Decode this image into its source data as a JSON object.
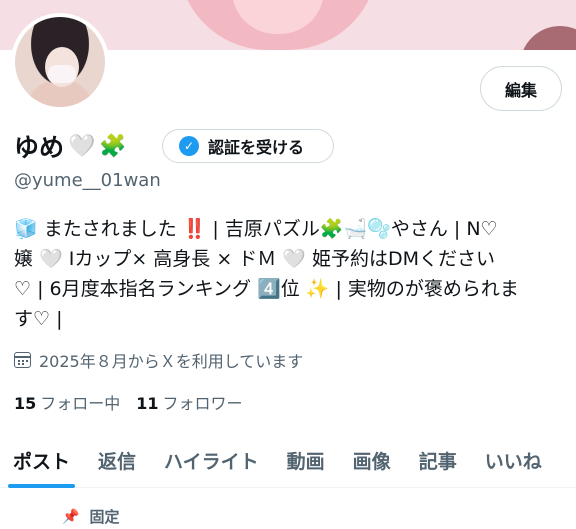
{
  "profile": {
    "display_name": "ゆめ",
    "name_emojis": [
      "🤍",
      "🧩"
    ],
    "verify_label": "認証を受ける",
    "handle": "@yume__01wan",
    "edit_label": "編集"
  },
  "bio": {
    "line1": "🧊 またされました ‼️ | 吉原パズル🧩🛁🫧やさん | N♡",
    "line2": "嬢 🤍 Iカップ× 高身長 × ドＭ 🤍 姫予約はDMください",
    "line3": "♡ | 6月度本指名ランキング 4️⃣位 ✨ | 実物のが褒められま",
    "line4": "す♡ |"
  },
  "joined": "2025年８月からＸを利用しています",
  "stats": {
    "following_count": "15",
    "following_label": "フォロー中",
    "followers_count": "11",
    "followers_label": "フォロワー"
  },
  "tabs": [
    "ポスト",
    "返信",
    "ハイライト",
    "動画",
    "画像",
    "記事",
    "いいね"
  ],
  "pinned_label": "固定",
  "colors": {
    "accent": "#1d9bf0",
    "secondary_text": "#536471",
    "banner": "#f6dfe4"
  }
}
